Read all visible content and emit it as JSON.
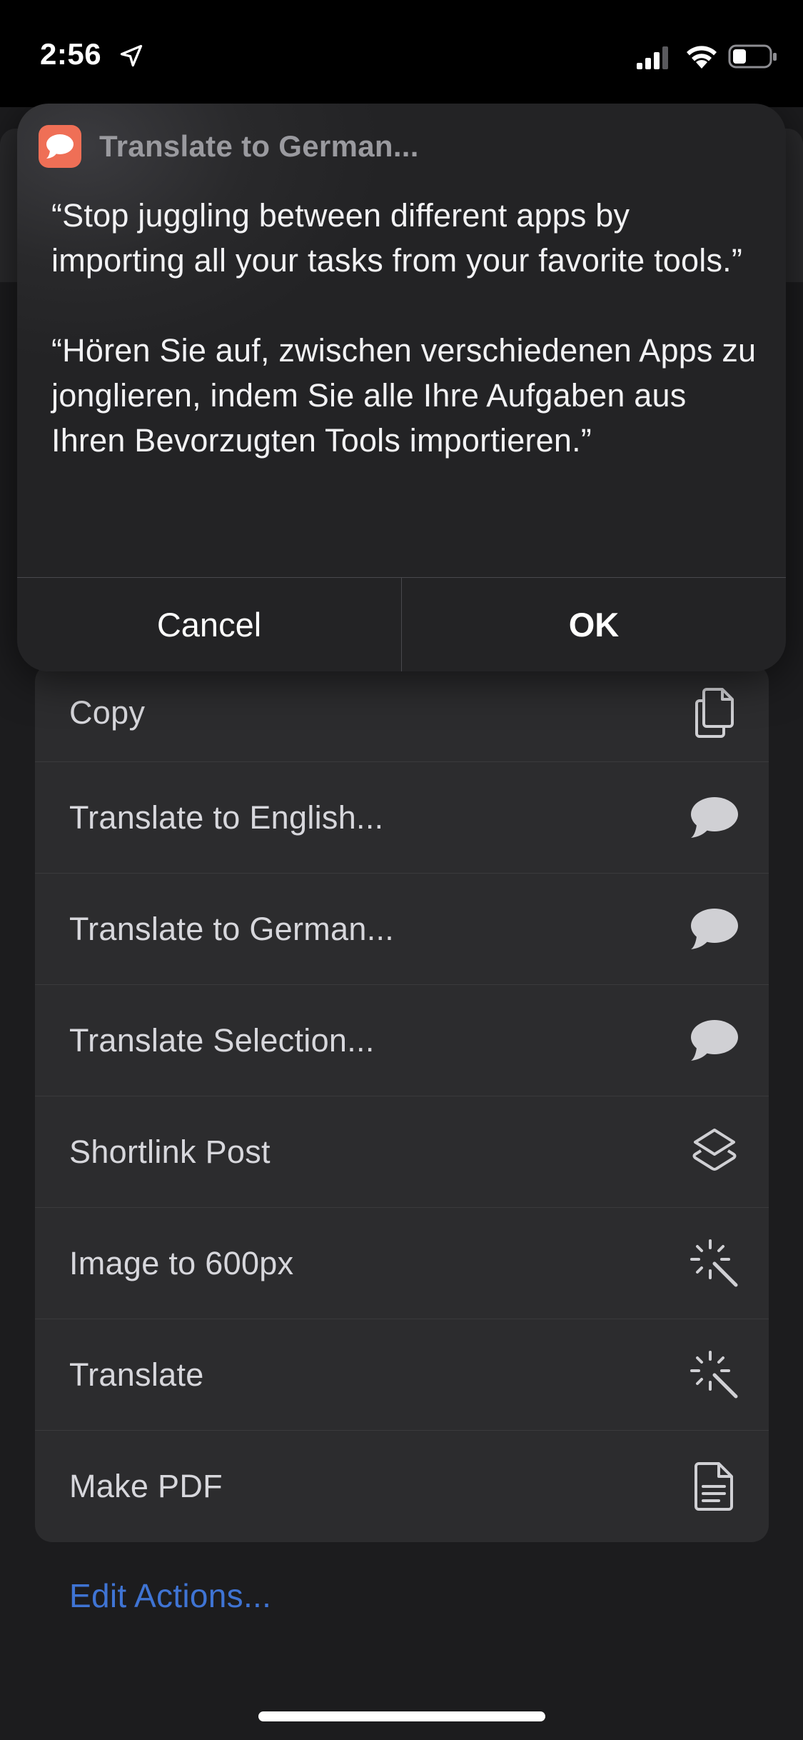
{
  "status_bar": {
    "time": "2:56",
    "icons": [
      "location-arrow-icon",
      "cellular-signal-icon",
      "wifi-icon",
      "battery-icon"
    ]
  },
  "alert": {
    "app_name": "Translate to German...",
    "app_icon": "speech-bubble-icon",
    "app_icon_color": "#ef6f56",
    "original_text": "“Stop juggling between different apps by importing all your tasks from your favorite tools.”",
    "translated_text": "“Hören Sie auf, zwischen verschiedenen Apps zu jonglieren, indem Sie alle Ihre Aufgaben aus Ihren Bevorzugten Tools importieren.”",
    "cancel_label": "Cancel",
    "ok_label": "OK"
  },
  "actions": [
    {
      "label": "Copy",
      "icon": "copy-icon"
    },
    {
      "label": "Translate to English...",
      "icon": "speech-bubble-icon"
    },
    {
      "label": "Translate to German...",
      "icon": "speech-bubble-icon"
    },
    {
      "label": "Translate Selection...",
      "icon": "speech-bubble-icon"
    },
    {
      "label": "Shortlink Post",
      "icon": "shortcuts-layers-icon"
    },
    {
      "label": "Image to 600px",
      "icon": "magic-wand-icon"
    },
    {
      "label": "Translate",
      "icon": "magic-wand-icon"
    },
    {
      "label": "Make PDF",
      "icon": "document-icon"
    }
  ],
  "edit_actions_label": "Edit Actions...",
  "colors": {
    "accent_link": "#3f74d4",
    "background": "#1c1c1e",
    "list_background": "#2c2c2e"
  }
}
